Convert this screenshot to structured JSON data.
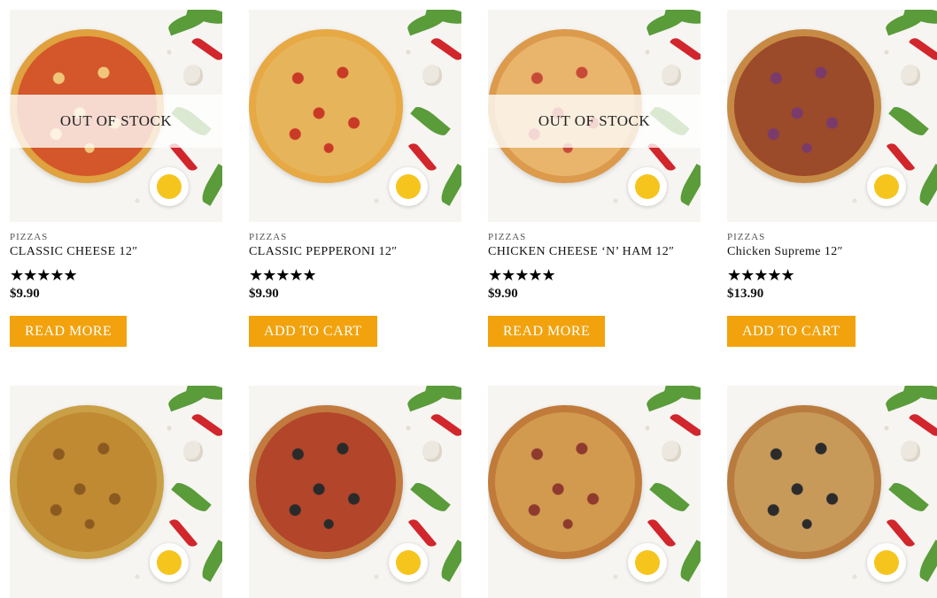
{
  "products": [
    {
      "category": "PIZZAS",
      "title": "CLASSIC CHEESE 12″",
      "price": "$9.90",
      "rating": 5,
      "stars": "★★★★★",
      "badge": "OUT OF STOCK",
      "button": "READ MORE",
      "pizza_color": "#e0a13f",
      "topping_color": "#d4562b",
      "accent": "#f0c77a"
    },
    {
      "category": "PIZZAS",
      "title": "CLASSIC PEPPERONI 12″",
      "price": "$9.90",
      "rating": 5,
      "stars": "★★★★★",
      "badge": "",
      "button": "ADD TO CART",
      "pizza_color": "#e7a944",
      "topping_color": "#e6b55b",
      "accent": "#c93a26"
    },
    {
      "category": "PIZZAS",
      "title": "CHICKEN CHEESE ‘N’ HAM 12″",
      "price": "$9.90",
      "rating": 5,
      "stars": "★★★★★",
      "badge": "OUT OF STOCK",
      "button": "READ MORE",
      "pizza_color": "#dc9a4c",
      "topping_color": "#e9b56c",
      "accent": "#c74a36"
    },
    {
      "category": "PIZZAS",
      "title": "Chicken Supreme 12″",
      "price": "$13.90",
      "rating": 5,
      "stars": "★★★★★",
      "badge": "",
      "button": "ADD TO CART",
      "pizza_color": "#c78a45",
      "topping_color": "#9b4a2a",
      "accent": "#7a3b6c"
    },
    {
      "category": "",
      "title": "",
      "price": "",
      "rating": 0,
      "stars": "",
      "badge": "",
      "button": "",
      "pizza_color": "#caa046",
      "topping_color": "#c08a32",
      "accent": "#8a5a20"
    },
    {
      "category": "",
      "title": "",
      "price": "",
      "rating": 0,
      "stars": "",
      "badge": "",
      "button": "",
      "pizza_color": "#c27a3e",
      "topping_color": "#b2452a",
      "accent": "#2a2a2a"
    },
    {
      "category": "",
      "title": "",
      "price": "",
      "rating": 0,
      "stars": "",
      "badge": "",
      "button": "",
      "pizza_color": "#c07a3a",
      "topping_color": "#d29a4e",
      "accent": "#8e3a2e"
    },
    {
      "category": "",
      "title": "",
      "price": "",
      "rating": 0,
      "stars": "",
      "badge": "",
      "button": "",
      "pizza_color": "#b97c3e",
      "topping_color": "#c89a5a",
      "accent": "#2b2b2b"
    }
  ],
  "colors": {
    "button_bg": "#f1a20d",
    "button_text": "#ffffff",
    "text": "#111111"
  }
}
